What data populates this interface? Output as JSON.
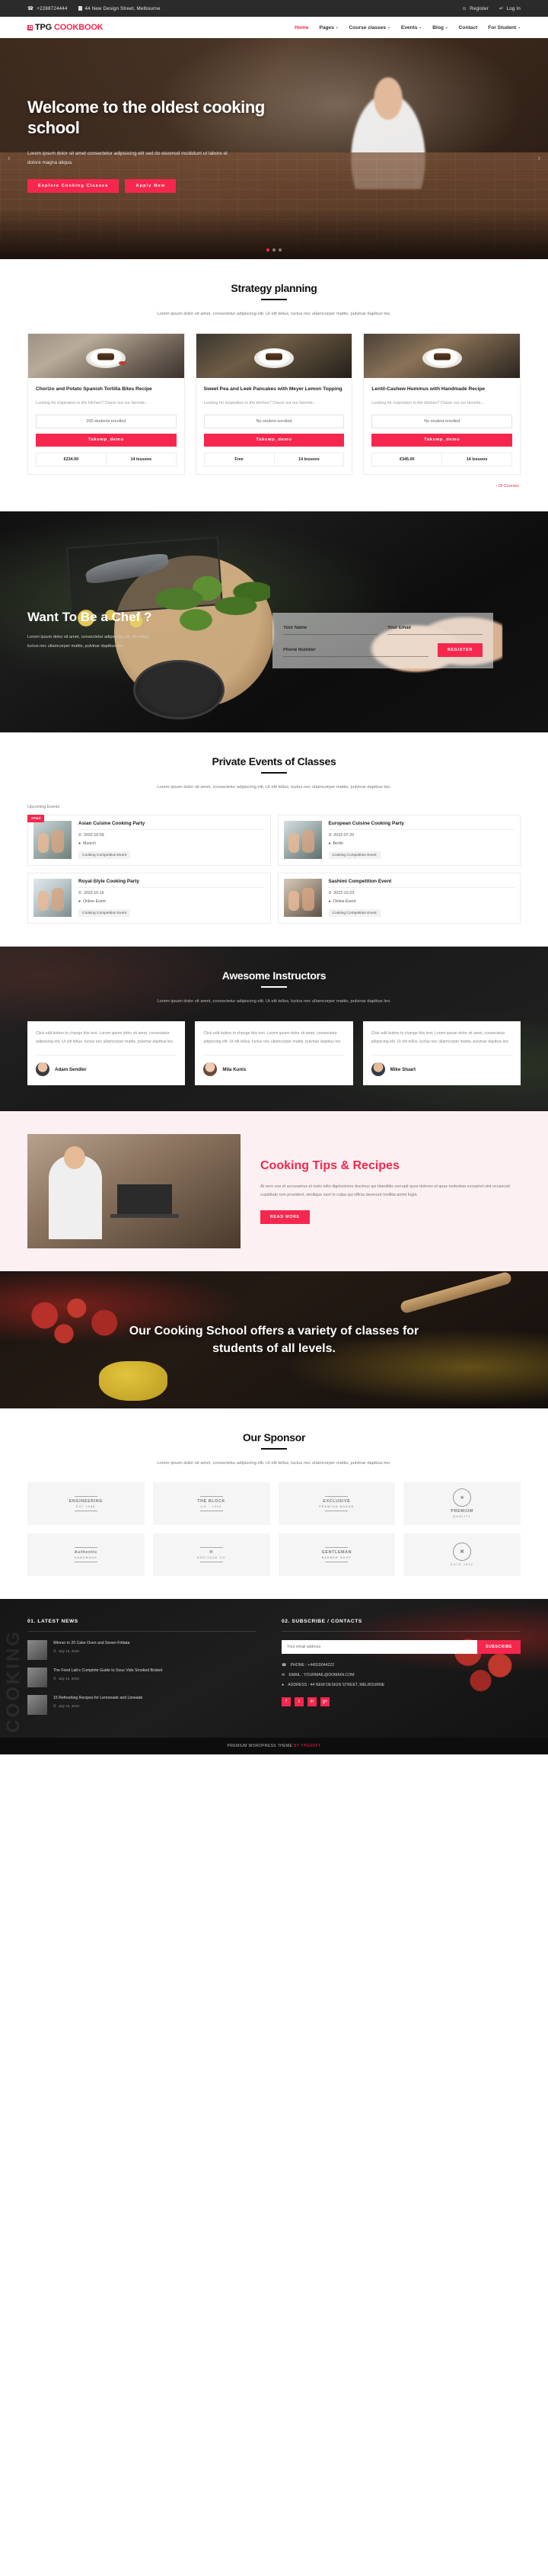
{
  "topbar": {
    "phone": "+2288724444",
    "address": "44 New Design Street, Melbourne",
    "register": "Register",
    "login": "Log In"
  },
  "brand": {
    "part1": "TPG ",
    "part2": "COOKBOOK"
  },
  "nav": {
    "items": [
      {
        "label": "Home",
        "caret": "",
        "active": true
      },
      {
        "label": "Pages",
        "caret": "⌄",
        "active": false
      },
      {
        "label": "Course classes",
        "caret": "⌄",
        "active": false
      },
      {
        "label": "Events",
        "caret": "⌄",
        "active": false
      },
      {
        "label": "Blog",
        "caret": "⌄",
        "active": false
      },
      {
        "label": "Contact",
        "caret": "",
        "active": false
      },
      {
        "label": "For Student",
        "caret": "⌄",
        "active": false
      }
    ]
  },
  "hero": {
    "title": "Welcome to the oldest cooking school",
    "desc": "Lorem ipsum dolor sit amet consectetur adipisicing elit sed do eiusmod incididunt ut labore et dolore magna aliqua.",
    "btn_primary": "Explore Cooking Classes",
    "btn_secondary": "Apply Now",
    "arrow_left": "‹",
    "arrow_right": "›"
  },
  "strategy": {
    "title": "Strategy planning",
    "subtitle": "Lorem ipsum dolor sit amet, consectetur adipiscing elit. Ut elit tellus, luctus nec ullamcorper mattis, pulvinar dapibus leo.",
    "see_all": "› Of Courses",
    "cards": [
      {
        "title": "Chorizo and Potato Spanish Tortilla Bites Recipe",
        "desc": "Looking for inspiration in the kitchen? Check out our favorite...",
        "enrolled": "200 students enrolled",
        "cta": "Takewp_demo",
        "price": "€234.00",
        "lessons": "14 lessons"
      },
      {
        "title": "Sweet Pea and Leek Pancakes with Meyer Lemon Topping",
        "desc": "Looking for inspiration in the kitchen? Check out our favorite...",
        "enrolled": "No student enrolled",
        "cta": "Takewp_demo",
        "price": "Free",
        "lessons": "14 lessons"
      },
      {
        "title": "Lentil-Cashew Hummus with Handmade Recipe",
        "desc": "Looking for inspiration in the kitchen? Check out our favorite...",
        "enrolled": "No student enrolled",
        "cta": "Takewp_demo",
        "price": "€345.00",
        "lessons": "14 lessons"
      }
    ]
  },
  "chef_banner": {
    "title": "Want To Be a Chef ?",
    "desc": "Lorem ipsum dolor sit amet, consectetur adipiscing elit, elit tellus, luctus nec ullamcorper mattis, pulvinar dapibus leo.",
    "form": {
      "name_placeholder": "Your Name",
      "email_placeholder": "Your Email",
      "phone_placeholder": "Phone Number",
      "submit": "REGISTER"
    }
  },
  "events": {
    "title": "Private Events of Classes",
    "subtitle": "Lorem ipsum dolor sit amet, consectetur adipiscing elit. Ut elit tellus, luctus nec ullamcorper mattis, pulvinar dapibus leo.",
    "upcoming_label": "Upcoming Events",
    "paid_badge": "#Paid",
    "items": [
      {
        "title": "Asian Cuisine Cooking Party",
        "date": "2022-10-09",
        "place": "Munich",
        "tag": "Cooking Competition Event",
        "paid": true
      },
      {
        "title": "European Cuisine Cooking Party",
        "date": "2022-07-20",
        "place": "Berlin",
        "tag": "Cooking Competition Event",
        "paid": false
      },
      {
        "title": "Royal-Style Cooking Party",
        "date": "2022-10-16",
        "place": "Online Event",
        "tag": "Cooking Competition Event",
        "paid": false
      },
      {
        "title": "Sashimi Competition Event",
        "date": "2022-10-23",
        "place": "Online Event",
        "tag": "Cooking Competition Event",
        "paid": false
      }
    ]
  },
  "instructors": {
    "title": "Awesome Instructors",
    "subtitle": "Lorem ipsum dolor sit amet, consectetur adipiscing elit. Ut elit tellus, luctus nec ullamcorper mattis, pulvinar dapibus leo.",
    "cards": [
      {
        "text": "Click edit button to change this text. Lorem ipsum dolor sit amet, consectetur adipiscing elit. Ut elit tellus, luctus nec ullamcorper mattis, pulvinar dapibus leo.",
        "name": "Adam Sendler"
      },
      {
        "text": "Click edit button to change this text. Lorem ipsum dolor sit amet, consectetur adipiscing elit. Ut elit tellus, luctus nec ullamcorper mattis, pulvinar dapibus leo.",
        "name": "Mila Kunis"
      },
      {
        "text": "Click edit button to change this text. Lorem ipsum dolor sit amet, consectetur adipiscing elit. Ut elit tellus, luctus nec ullamcorper mattis, pulvinar dapibus leo.",
        "name": "Mike Stuart"
      }
    ]
  },
  "tips": {
    "title": "Cooking Tips & Recipes",
    "desc": "At vero eos et accusamus et iusto odio dignissimos ducimus qui blanditiis corrupti quos dolores et quas molestias excepturi sint occaecati cupiditate non provident, similique sunt in culpa qui officia deserunt mollitia animi fugia.",
    "cta": "READ MORE"
  },
  "variety": {
    "title": "Our Cooking School offers a variety of classes for students of all levels."
  },
  "sponsor": {
    "title": "Our Sponsor",
    "subtitle": "Lorem ipsum dolor sit amet, consectetur adipiscing elit. Ut elit tellus, luctus nec ullamcorper mattis, pulvinar dapibus leo.",
    "logos": [
      {
        "name": "ENGINEERING",
        "sub": "EST 1986",
        "style": "bar"
      },
      {
        "name": "THE BLOCK",
        "sub": "CO · 1924",
        "style": "bar"
      },
      {
        "name": "EXCLUSIVE",
        "sub": "PREMIUM BRAND",
        "style": "bar"
      },
      {
        "name": "PREMIUM",
        "sub": "QUALITY",
        "style": "ring"
      },
      {
        "name": "Authentic",
        "sub": "HANDMADE",
        "style": "bar"
      },
      {
        "name": "H",
        "sub": "HERITAGE CO",
        "style": "bar"
      },
      {
        "name": "GENTLEMAN",
        "sub": "BARBER SHOP",
        "style": "bar"
      },
      {
        "name": "",
        "sub": "ESTD 1910",
        "style": "ring"
      }
    ]
  },
  "footer": {
    "vertical_word": "COOKING",
    "news": {
      "heading": "01. LATEST NEWS",
      "items": [
        {
          "title": "Winner in 20 Cake Oven and Seven Frittata",
          "date": "July 15, 2018"
        },
        {
          "title": "The Food Lab's Complete Guide to Sous Vide Smoked Brisket",
          "date": "July 15, 2018"
        },
        {
          "title": "15 Refreshing Recipes for Lemonade and Limeade",
          "date": "July 15, 2018"
        }
      ]
    },
    "subscribe": {
      "heading": "02. SUBSCRIBE / CONTACTS",
      "placeholder": "Your email address",
      "button": "SUBSCRIBE",
      "phone": "PHONE : +44919044222",
      "email": "EMAIL : YOURMAIL@DOMAIN.COM",
      "address": "ADDRESS : 44 NEW DESIGN STREET, MELBOURNE"
    },
    "social": [
      "f",
      "t",
      "in",
      "g+"
    ],
    "copyright_pre": "PREMIUM WORDPRESS THEME ",
    "copyright_by": "BY TPGSOFT"
  },
  "icons": {
    "phone": "☎",
    "location": "▤",
    "register": "☺",
    "login": "↩",
    "clock": "◴",
    "pin": "▼",
    "mail": "✉"
  }
}
